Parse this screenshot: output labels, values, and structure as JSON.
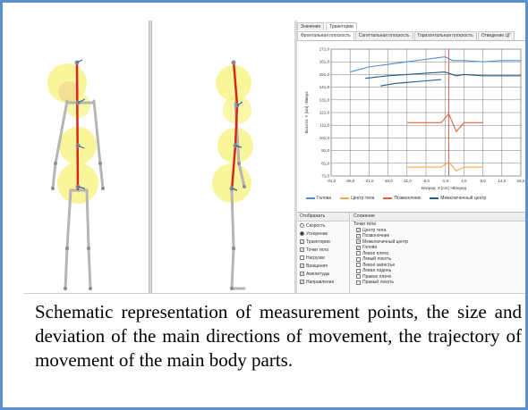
{
  "tabs_top": [
    "Значения",
    "Траектории"
  ],
  "tabs_plane": [
    "Фронтальная плоскость",
    "Сагиттальная плоскость",
    "Горизонтальная плоскость",
    "Отведение ЦГ"
  ],
  "colors": {
    "border": "#5b8fd1",
    "head": "#4f8fd8",
    "center": "#f2a84a",
    "spine": "#e0643a",
    "intercenter": "#1f5c8a",
    "zone": "#f7f27a"
  },
  "chart_data": {
    "type": "line",
    "xlabel": "Вперед: X [cm] >Вперед",
    "ylabel": "Высота: Y [cm] >Вверх",
    "x_ticks": [
      "-31,0",
      "-26,0",
      "-21,0",
      "-16,0",
      "-11,0",
      "-6,0",
      "-1,0",
      "4,0",
      "9,0",
      "14,0",
      "19,0"
    ],
    "y_ticks": [
      "171,0",
      "161,0",
      "151,0",
      "141,0",
      "131,0",
      "121,0",
      "111,0",
      "101,0",
      "91,0",
      "81,0",
      "71,0"
    ],
    "xlim": [
      -31,
      19
    ],
    "ylim": [
      71,
      171
    ],
    "grid": true,
    "series": [
      {
        "name": "Голова",
        "color": "#4f8fd8",
        "x": [
          -26,
          -21,
          -16,
          -11,
          -6,
          -1,
          1,
          4,
          9,
          14,
          19
        ],
        "y": [
          153,
          157,
          159,
          161,
          163,
          165,
          162,
          162,
          161,
          162,
          162
        ]
      },
      {
        "name": "Межключичный центр",
        "color": "#1f5c8a",
        "x": [
          -22,
          -16,
          -11,
          -6,
          -1,
          2,
          4,
          9,
          14,
          19
        ],
        "y": [
          148,
          150,
          151,
          152,
          153,
          150,
          151,
          150,
          150,
          150
        ]
      },
      {
        "name": "Межключичный центр",
        "color": "#1f5c8a",
        "x": [
          -18,
          -14,
          -10,
          -6,
          -2
        ],
        "y": [
          142,
          144,
          145,
          146,
          147
        ]
      },
      {
        "name": "Позвоночник",
        "color": "#e0643a",
        "x": [
          -11,
          -6,
          -2,
          0,
          2,
          4,
          9
        ],
        "y": [
          113,
          113,
          113,
          120,
          106,
          113,
          113
        ]
      },
      {
        "name": "Центр тела",
        "color": "#f2a84a",
        "x": [
          -11,
          -6,
          -2,
          0,
          2,
          4,
          9
        ],
        "y": [
          78,
          78,
          78,
          82,
          75,
          78,
          78
        ]
      }
    ]
  },
  "legend": [
    "Голова",
    "Центр тела",
    "Позвоночник",
    "Межключичный центр"
  ],
  "options": {
    "header": "Отображать",
    "radios": [
      {
        "label": "Скорость",
        "checked": false
      },
      {
        "label": "Ускорение",
        "checked": true
      }
    ],
    "checks": [
      {
        "label": "Траектории",
        "checked": true
      },
      {
        "label": "Точки тела",
        "checked": true
      },
      {
        "label": "Нагрузки",
        "checked": false
      },
      {
        "label": "Вращения",
        "checked": true
      },
      {
        "label": "Амплитуды",
        "checked": true
      },
      {
        "label": "Направления",
        "checked": true
      }
    ]
  },
  "list": {
    "header": "Сложение",
    "root": "Точки тела",
    "items": [
      {
        "label": "Центр тела",
        "checked": true
      },
      {
        "label": "Позвоночник",
        "checked": true
      },
      {
        "label": "Межключичный центр",
        "checked": true
      },
      {
        "label": "Голова",
        "checked": true
      },
      {
        "label": "Левое плечо",
        "checked": false
      },
      {
        "label": "Левый локоть",
        "checked": false
      },
      {
        "label": "Левое запястье",
        "checked": false
      },
      {
        "label": "Левая ладонь",
        "checked": false
      },
      {
        "label": "Правое плечо",
        "checked": false
      },
      {
        "label": "Правый локоть",
        "checked": false
      }
    ]
  },
  "caption": "Schematic representation of measurement points, the size and deviation of the main directions of movement, the trajectory of movement of the main body parts."
}
